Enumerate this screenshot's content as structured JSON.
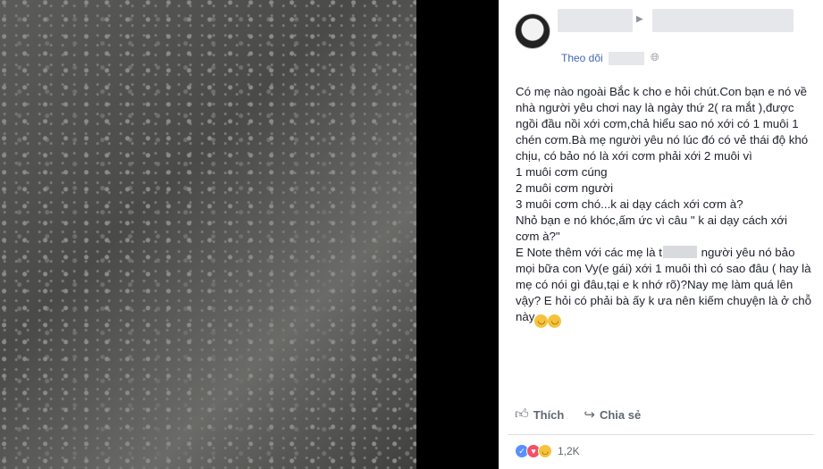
{
  "post": {
    "follow_label": "Theo dõi",
    "body_part1": "Có mẹ nào ngoài Bắc k cho e hỏi chút.Con bạn e nó về nhà người yêu chơi nay là ngày thứ 2( ra mắt ),được ngồi đầu nồi xới cơm,chả hiểu sao nó xới có 1 muôi 1 chén cơm.Bà mẹ người yêu nó lúc đó có vẻ thái độ khó chịu, có bảo nó là xới cơm phải xới 2 muôi vì\n1 muôi cơm cúng\n2 muôi cơm người\n3 muôi cơm chó...k ai dạy cách xới cơm à?\nNhỏ bạn e nó khóc,ấm ức vì câu \" k ai dạy cách xới cơm à?\"\nE Note thêm với các mẹ là t",
    "body_part2": " người yêu nó bảo mọi bữa con Vy(e gái) xới 1 muôi thì có sao đâu ( hay là mẹ có nói gì đâu,tại e k nhớ rõ)?Nay mẹ làm quá lên vậy? E hỏi có phải bà ấy k ưa nên kiếm chuyện là ở chỗ này"
  },
  "actions": {
    "like_label": "Thích",
    "share_label": "Chia sẻ"
  },
  "reactions": {
    "count": "1,2K"
  },
  "icons": {
    "globe": "globe-icon",
    "like": "thumbs-up-icon",
    "share": "share-arrow-icon",
    "emoji": "laughing-emoji-icon"
  }
}
